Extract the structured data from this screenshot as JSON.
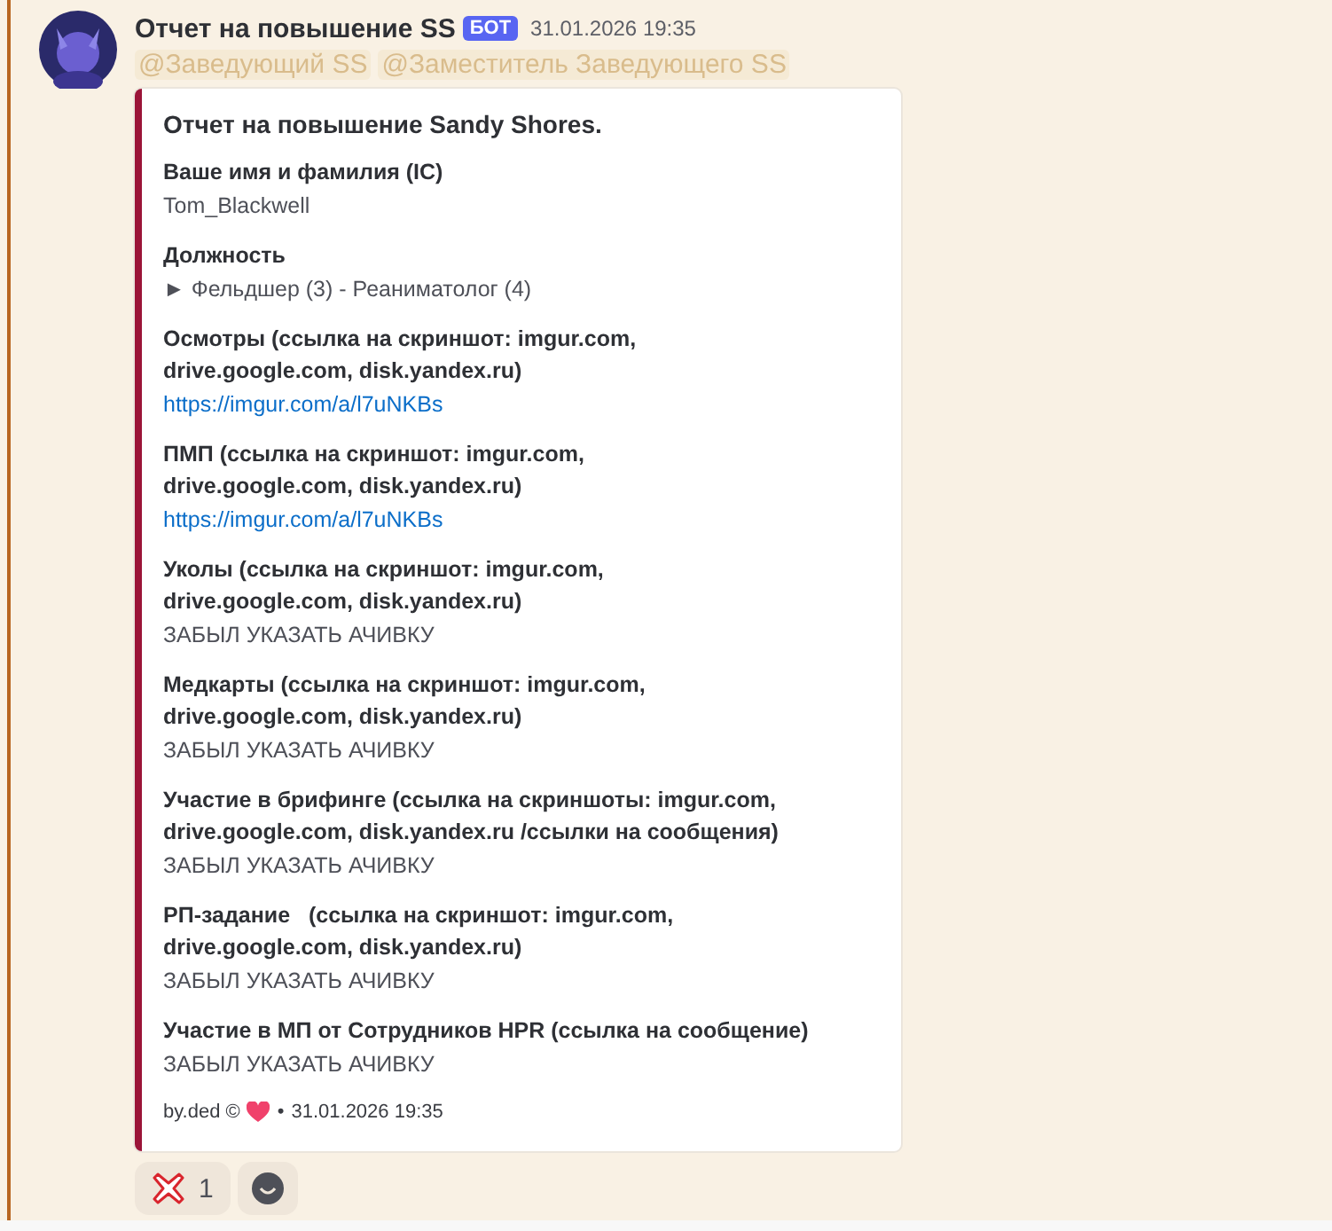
{
  "message": {
    "author": "Отчет на повышение SS",
    "badge": "БОТ",
    "timestamp": "31.01.2026 19:35",
    "mentions": [
      "@Заведующий SS",
      "@Заместитель Заведующего SS"
    ],
    "embed": {
      "title": "Отчет на повышение Sandy Shores.",
      "fields": [
        {
          "name": "Ваше имя и фамилия (IC)",
          "value": "Tom_Blackwell",
          "kind": "text"
        },
        {
          "name": "Должность",
          "value": "► Фельдшер (3) - Реаниматолог (4)",
          "kind": "text"
        },
        {
          "name": "Осмотры (ссылка на скриншот: imgur.com,\ndrive.google.com, disk.yandex.ru)",
          "value": "https://imgur.com/a/l7uNKBs",
          "kind": "link"
        },
        {
          "name": "ПМП (ссылка на скриншот: imgur.com,\ndrive.google.com, disk.yandex.ru)",
          "value": "https://imgur.com/a/l7uNKBs",
          "kind": "link"
        },
        {
          "name": "Уколы (ссылка на скриншот: imgur.com,\ndrive.google.com, disk.yandex.ru)",
          "value": "ЗАБЫЛ УКАЗАТЬ АЧИВКУ",
          "kind": "text"
        },
        {
          "name": "Медкарты (ссылка на скриншот: imgur.com,\ndrive.google.com, disk.yandex.ru)",
          "value": "ЗАБЫЛ УКАЗАТЬ АЧИВКУ",
          "kind": "text"
        },
        {
          "name": "Участие в брифинге (ссылка на скриншоты: imgur.com,\ndrive.google.com, disk.yandex.ru /ссылки на сообщения)",
          "value": "ЗАБЫЛ УКАЗАТЬ АЧИВКУ",
          "kind": "text"
        },
        {
          "name": "РП-задание   (ссылка на скриншот: imgur.com,\ndrive.google.com, disk.yandex.ru)",
          "value": "ЗАБЫЛ УКАЗАТЬ АЧИВКУ",
          "kind": "text"
        },
        {
          "name": "Участие в МП от Сотрудников HPR (ссылка на сообщение)",
          "value": "ЗАБЫЛ УКАЗАТЬ АЧИВКУ",
          "kind": "text"
        }
      ],
      "footer": {
        "text": "by.ded ©",
        "separator": "•",
        "timestamp": "31.01.2026 19:35"
      }
    },
    "reactions": [
      {
        "count": "1"
      }
    ]
  }
}
